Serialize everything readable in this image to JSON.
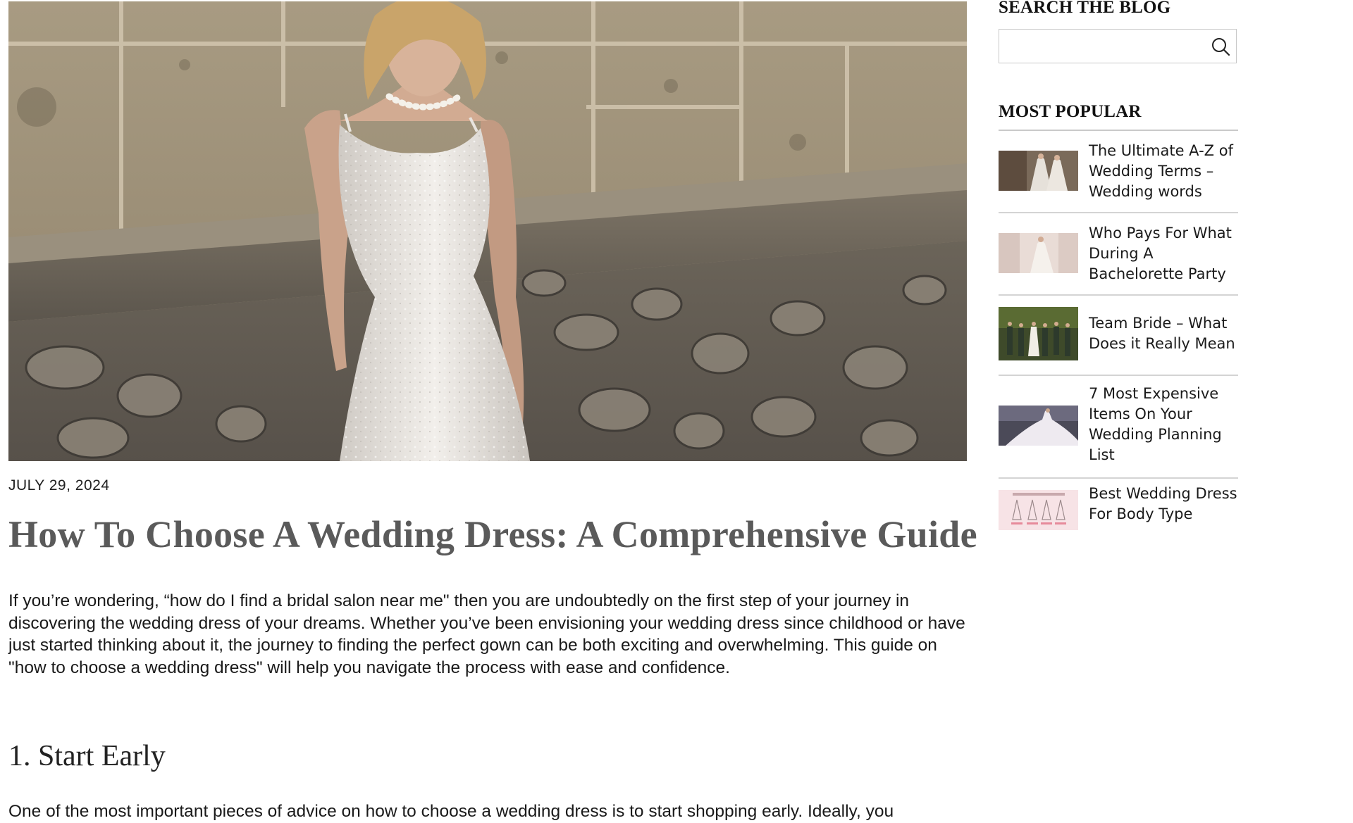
{
  "post": {
    "date": "JULY 29, 2024",
    "title": "How To Choose A Wedding Dress: A Comprehensive Guide",
    "intro": "If you’re wondering, “how do I find a bridal salon near me\" then you are undoubtedly on the first step of your journey in discovering the wedding dress of your dreams. Whether you’ve been envisioning your wedding dress since childhood or have just started thinking about it, the journey to finding the perfect gown can be both exciting and overwhelming. This guide on \"how to choose a wedding dress\" will help you navigate the process with ease and confidence.",
    "section_1_heading": "1. Start Early",
    "section_1_text": "One of the most important pieces of advice on how to choose a wedding dress is to start shopping early. Ideally, you"
  },
  "sidebar": {
    "search_heading": "SEARCH THE BLOG",
    "search_value": "",
    "search_placeholder": "",
    "popular_heading": "MOST POPULAR",
    "popular_items": [
      {
        "title": "The Ultimate A-Z of Wedding Terms – Wedding words"
      },
      {
        "title": "Who Pays For What During A Bachelorette Party"
      },
      {
        "title": "Team Bride – What Does it Really Mean"
      },
      {
        "title": "7 Most Expensive Items On Your Wedding Planning List"
      },
      {
        "title": "Best Wedding Dress For Body Type"
      }
    ]
  },
  "icons": {
    "search": "search-icon"
  },
  "colors": {
    "title_gray": "#5a5a5a",
    "divider": "#d4d4d4"
  }
}
